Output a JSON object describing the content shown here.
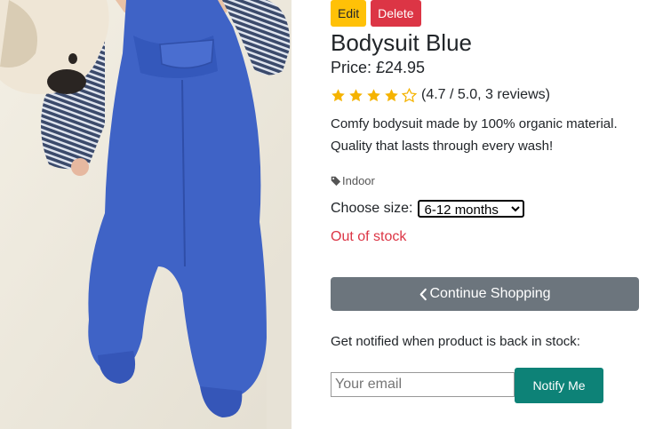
{
  "admin": {
    "edit_label": "Edit",
    "delete_label": "Delete"
  },
  "product": {
    "image_alt": "Blue baby bodysuit lying next to a plush toy",
    "name": "Bodysuit Blue",
    "price": "Price: £24.95",
    "rating_value": 4.7,
    "rating_max": 5,
    "rating_text": "(4.7 / 5.0, 3 reviews)",
    "description_lines": [
      "Comfy bodysuit made by 100% organic material.",
      "Quality that lasts through every wash!"
    ],
    "tag": "Indoor",
    "size_label": "Choose size:",
    "size_selected": "6-12 months",
    "stock_status": "Out of stock"
  },
  "actions": {
    "continue_label": "Continue Shopping"
  },
  "notify": {
    "prompt": "Get notified when product is back in stock:",
    "email_placeholder": "Your email",
    "button_label": "Notify Me"
  },
  "colors": {
    "edit": "#ffc107",
    "delete": "#dc3545",
    "star": "#f5b301",
    "continue": "#6c757d",
    "notify": "#0d8277",
    "out_of_stock": "#dc3545"
  },
  "icons": {
    "star": "star-icon",
    "tag": "tag-icon",
    "back": "chevron-left-icon"
  }
}
